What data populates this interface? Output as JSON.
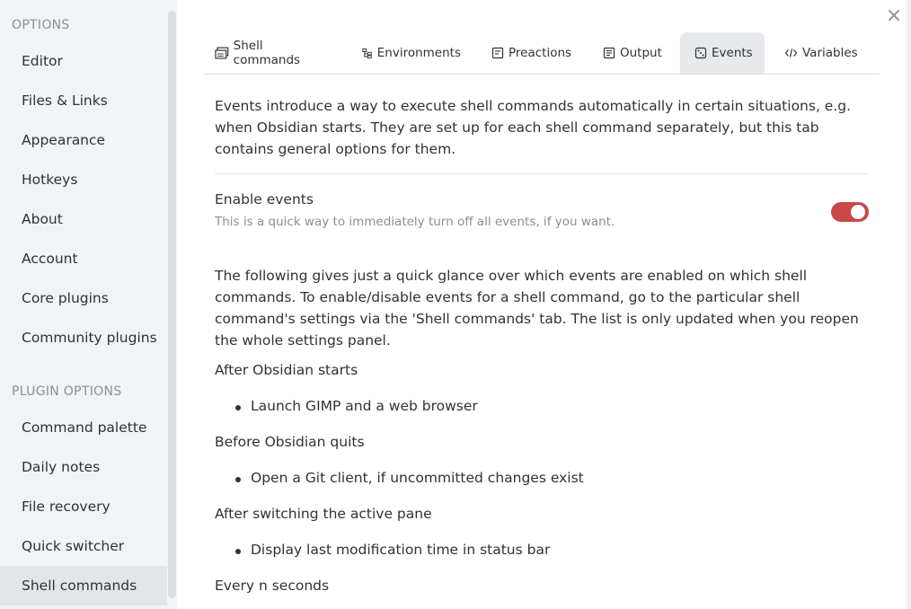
{
  "sidebar": {
    "options_heading": "OPTIONS",
    "options": [
      {
        "label": "Editor"
      },
      {
        "label": "Files & Links"
      },
      {
        "label": "Appearance"
      },
      {
        "label": "Hotkeys"
      },
      {
        "label": "About"
      },
      {
        "label": "Account"
      },
      {
        "label": "Core plugins"
      },
      {
        "label": "Community plugins"
      }
    ],
    "plugin_heading": "PLUGIN OPTIONS",
    "plugin_options": [
      {
        "label": "Command palette"
      },
      {
        "label": "Daily notes"
      },
      {
        "label": "File recovery"
      },
      {
        "label": "Quick switcher"
      },
      {
        "label": "Shell commands",
        "active": true
      }
    ]
  },
  "close_icon": "×",
  "tabs": [
    {
      "label": "Shell commands",
      "icon": "terminal-stack-icon"
    },
    {
      "label": "Environments",
      "icon": "tree-icon"
    },
    {
      "label": "Preactions",
      "icon": "form-icon"
    },
    {
      "label": "Output",
      "icon": "output-icon"
    },
    {
      "label": "Events",
      "icon": "dice-icon",
      "active": true
    },
    {
      "label": "Variables",
      "icon": "code-icon"
    }
  ],
  "events_tab": {
    "intro": "Events introduce a way to execute shell commands automatically in certain situations, e.g. when Obsidian starts. They are set up for each shell command separately, but this tab contains general options for them.",
    "enable": {
      "name": "Enable events",
      "description": "This is a quick way to immediately turn off all events, if you want.",
      "enabled": true
    },
    "overview": "The following gives just a quick glance over which events are enabled on which shell commands. To enable/disable events for a shell command, go to the particular shell command's settings via the 'Shell commands' tab. The list is only updated when you reopen the whole settings panel.",
    "events": [
      {
        "title": "After Obsidian starts",
        "commands": [
          "Launch GIMP and a web browser"
        ]
      },
      {
        "title": "Before Obsidian quits",
        "commands": [
          "Open a Git client, if uncommitted changes exist"
        ]
      },
      {
        "title": "After switching the active pane",
        "commands": [
          "Display last modification time in status bar"
        ]
      },
      {
        "title": "Every n seconds",
        "commands": []
      }
    ]
  },
  "colors": {
    "accent": "#c94848",
    "sidebar_bg": "#f2f3f5",
    "active_bg": "#e3e5e8"
  }
}
